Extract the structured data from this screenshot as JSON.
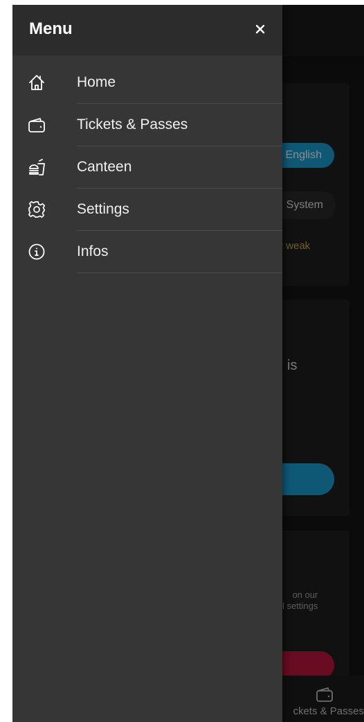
{
  "drawer": {
    "title": "Menu",
    "close_label": "×",
    "items": [
      {
        "label": "Home",
        "icon": "home-icon"
      },
      {
        "label": "Tickets & Passes",
        "icon": "wallet-icon"
      },
      {
        "label": "Canteen",
        "icon": "food-icon"
      },
      {
        "label": "Settings",
        "icon": "gear-icon"
      },
      {
        "label": "Infos",
        "icon": "info-icon"
      }
    ]
  },
  "background": {
    "language_option": "English",
    "theme_option": "System",
    "weak_note": "r weak",
    "text_fragment": "is",
    "notes_line1": "on our",
    "notes_line2": "l settings",
    "bottom_nav_label": "ckets & Passes"
  },
  "colors": {
    "accent_blue": "#1aa0d6",
    "accent_red": "#c0143c",
    "warning_gold": "#c9a94a",
    "drawer_bg": "#363636",
    "drawer_header_bg": "#2c2c2c"
  }
}
